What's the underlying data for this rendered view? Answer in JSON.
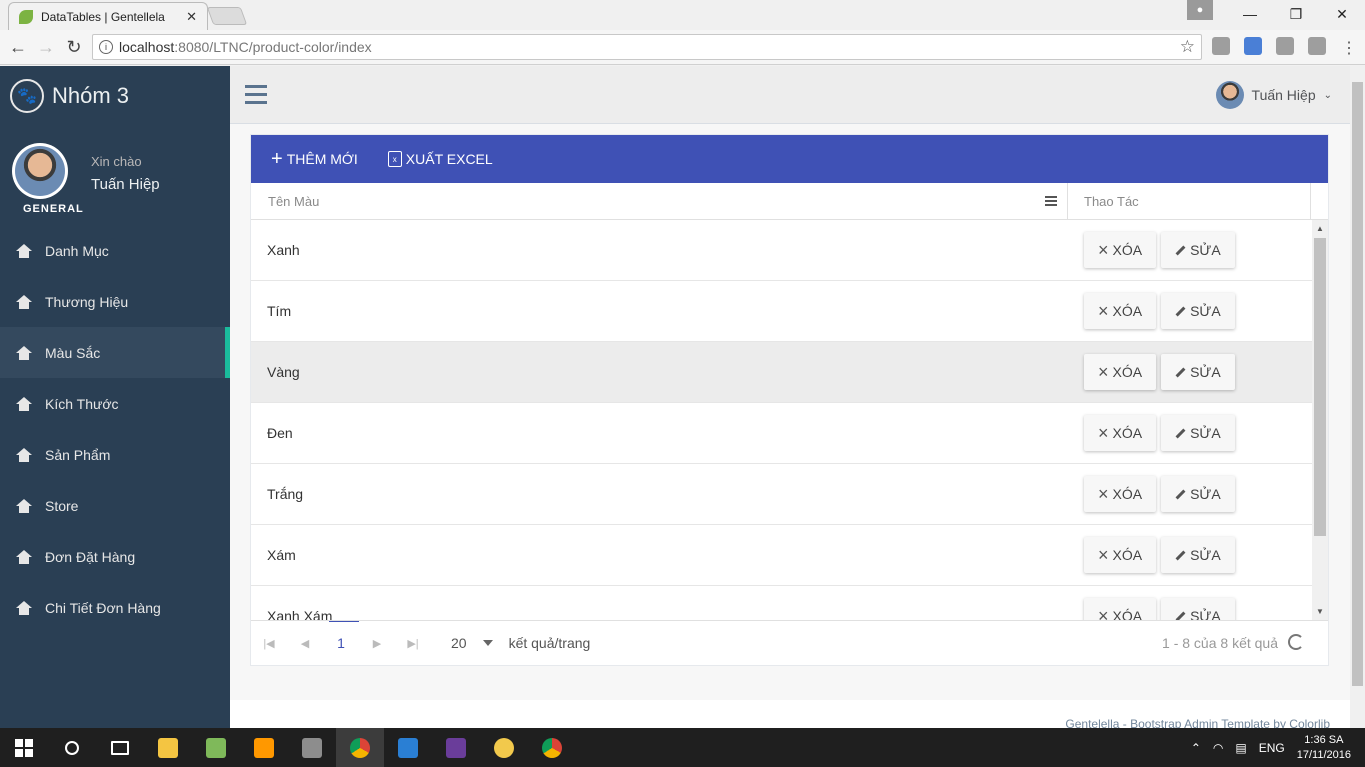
{
  "browser": {
    "tab_title": "DataTables | Gentellela",
    "url_host": "localhost",
    "url_rest": ":8080/LTNC/product-color/index"
  },
  "sidebar": {
    "brand": "Nhóm 3",
    "greeting": "Xin chào",
    "user_name": "Tuấn Hiệp",
    "section": "GENERAL",
    "items": [
      {
        "label": "Danh Mục"
      },
      {
        "label": "Thương Hiệu"
      },
      {
        "label": "Màu Sắc"
      },
      {
        "label": "Kích Thước"
      },
      {
        "label": "Sản Phẩm"
      },
      {
        "label": "Store"
      },
      {
        "label": "Đơn Đặt Hàng"
      },
      {
        "label": "Chi Tiết Đơn Hàng"
      }
    ],
    "active_item": "Màu Sắc"
  },
  "topnav": {
    "user_name": "Tuấn Hiệp"
  },
  "toolbar": {
    "add_label": "THÊM MỚI",
    "export_label": "XUẤT EXCEL"
  },
  "table": {
    "columns": [
      "Tên Màu",
      "Thao Tác"
    ],
    "rows": [
      {
        "name": "Xanh"
      },
      {
        "name": "Tím"
      },
      {
        "name": "Vàng"
      },
      {
        "name": "Đen"
      },
      {
        "name": "Trắng"
      },
      {
        "name": "Xám"
      },
      {
        "name": "Xanh Xám"
      }
    ],
    "delete_label": "XÓA",
    "edit_label": "SỬA",
    "highlighted_row": "Vàng"
  },
  "pager": {
    "current_page": "1",
    "page_size": "20",
    "page_size_label": "kết quả/trang",
    "info": "1 - 8 của 8 kết quả"
  },
  "footer": {
    "text": "Gentelella - Bootstrap Admin Template by Colorlib"
  },
  "taskbar": {
    "lang": "ENG",
    "time": "1:36 SA",
    "date": "17/11/2016"
  },
  "colors": {
    "primary": "#3f51b5",
    "sidebar": "#2a3f54",
    "accent": "#1abb9c"
  }
}
